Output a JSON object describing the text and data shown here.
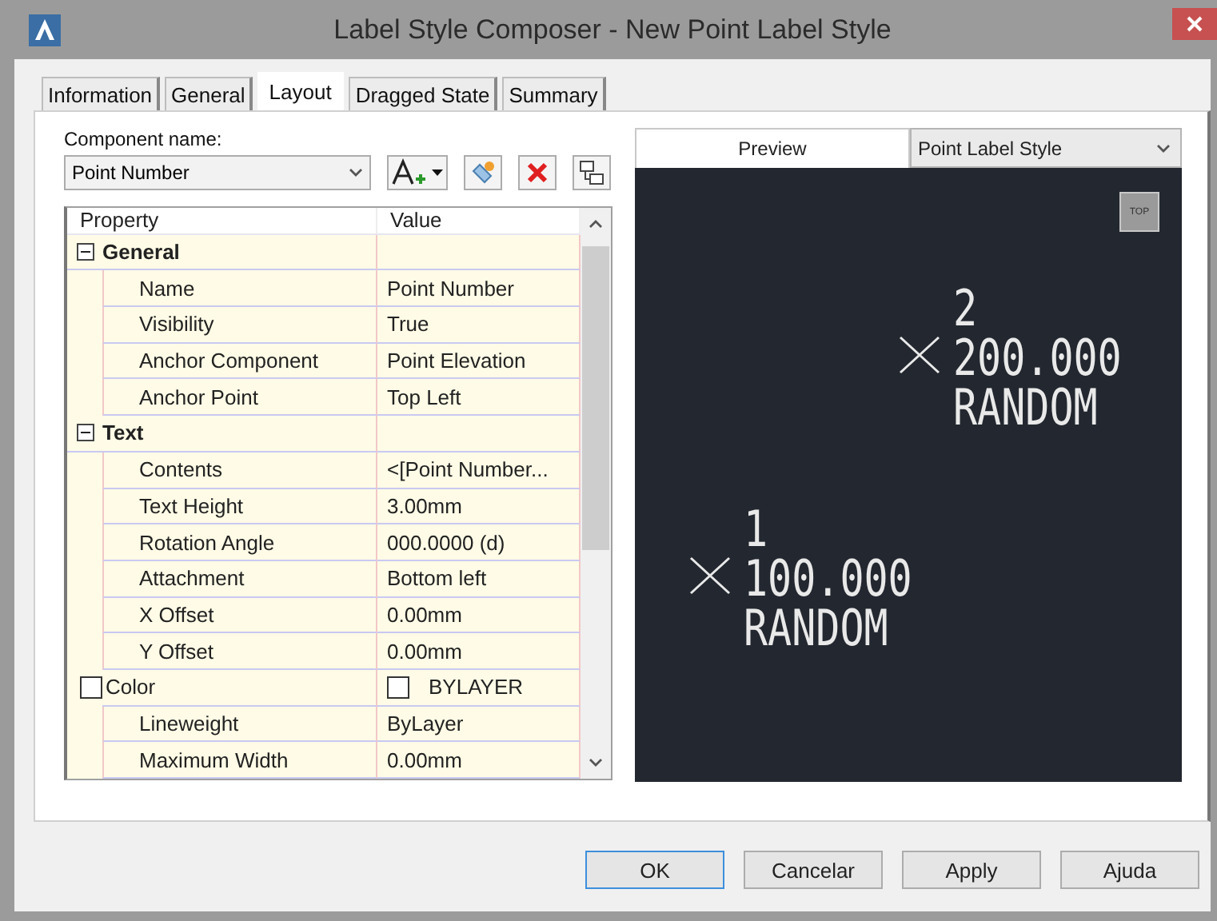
{
  "window": {
    "title": "Label Style Composer - New Point Label Style"
  },
  "tabs": [
    {
      "label": "Information",
      "selected": false
    },
    {
      "label": "General",
      "selected": false
    },
    {
      "label": "Layout",
      "selected": true
    },
    {
      "label": "Dragged State",
      "selected": false
    },
    {
      "label": "Summary",
      "selected": false
    }
  ],
  "component": {
    "label": "Component name:",
    "value": "Point Number"
  },
  "property_grid": {
    "columns": [
      "Property",
      "Value"
    ],
    "rows": [
      {
        "kind": "category",
        "label": "General",
        "expanded": true
      },
      {
        "kind": "property",
        "label": "Name",
        "value": "Point Number"
      },
      {
        "kind": "property",
        "label": "Visibility",
        "value": "True"
      },
      {
        "kind": "property",
        "label": "Anchor Component",
        "value": "Point Elevation"
      },
      {
        "kind": "property",
        "label": "Anchor Point",
        "value": "Top Left"
      },
      {
        "kind": "category",
        "label": "Text",
        "expanded": true
      },
      {
        "kind": "property",
        "label": "Contents",
        "value": "<[Point Number..."
      },
      {
        "kind": "property",
        "label": "Text Height",
        "value": "3.00mm"
      },
      {
        "kind": "property",
        "label": "Rotation Angle",
        "value": "000.0000 (d)"
      },
      {
        "kind": "property",
        "label": "Attachment",
        "value": "Bottom left"
      },
      {
        "kind": "property",
        "label": "X Offset",
        "value": "0.00mm"
      },
      {
        "kind": "property",
        "label": "Y Offset",
        "value": "0.00mm"
      },
      {
        "kind": "color",
        "label": "Color",
        "value": "BYLAYER"
      },
      {
        "kind": "property",
        "label": "Lineweight",
        "value": "ByLayer"
      },
      {
        "kind": "property",
        "label": "Maximum Width",
        "value": "0.00mm"
      }
    ]
  },
  "preview": {
    "tab": "Preview",
    "style": "Point Label Style",
    "view_cube": "TOP",
    "points": [
      {
        "number": "2",
        "elevation": "200.000",
        "description": "RANDOM"
      },
      {
        "number": "1",
        "elevation": "100.000",
        "description": "RANDOM"
      }
    ]
  },
  "buttons": [
    {
      "label": "OK",
      "default": true
    },
    {
      "label": "Cancelar",
      "default": false
    },
    {
      "label": "Apply",
      "default": false
    },
    {
      "label": "Ajuda",
      "default": false
    }
  ]
}
